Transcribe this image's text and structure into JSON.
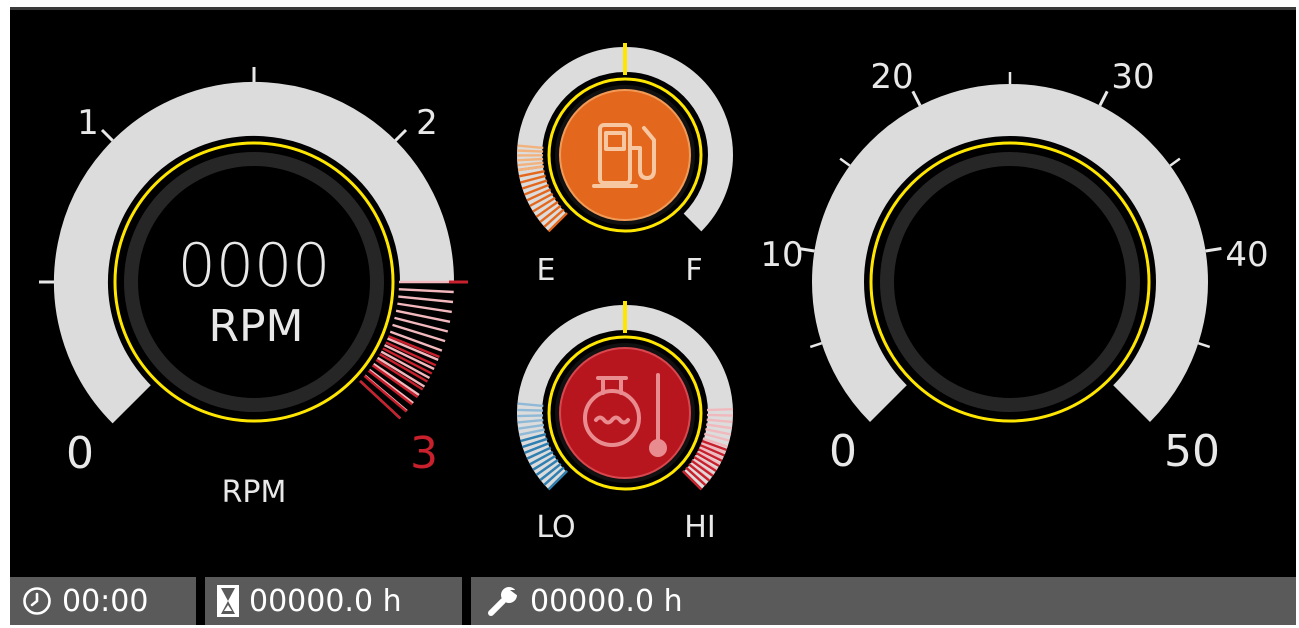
{
  "tachometer": {
    "readout_value": "0000",
    "readout_unit": "RPM",
    "caption": "RPM",
    "scale_labels": [
      "0",
      "1",
      "2",
      "3"
    ],
    "redline_label": "3"
  },
  "fuel_gauge": {
    "icon": "fuel-pump-icon",
    "empty_label": "E",
    "full_label": "F"
  },
  "temperature_gauge": {
    "icon": "coolant-temperature-icon",
    "low_label": "LO",
    "high_label": "HI"
  },
  "speedometer": {
    "scale_labels": [
      "0",
      "10",
      "20",
      "30",
      "40",
      "50"
    ]
  },
  "status_bar": {
    "clock_icon": "clock-icon",
    "clock_value": "00:00",
    "hours_icon": "hourglass-icon",
    "hours_value": "00000.0 h",
    "service_icon": "wrench-icon",
    "service_value": "00000.0 h"
  },
  "colors": {
    "panel_bg": "#000000",
    "track": "#dcdcdc",
    "yellow_ring": "#ffe600",
    "redline": "#c8202c",
    "fuel_orange": "#e3681e",
    "temp_red": "#b8161e",
    "cold_blue": "#2f7fb0",
    "status_bar": "#5a5a5a"
  }
}
